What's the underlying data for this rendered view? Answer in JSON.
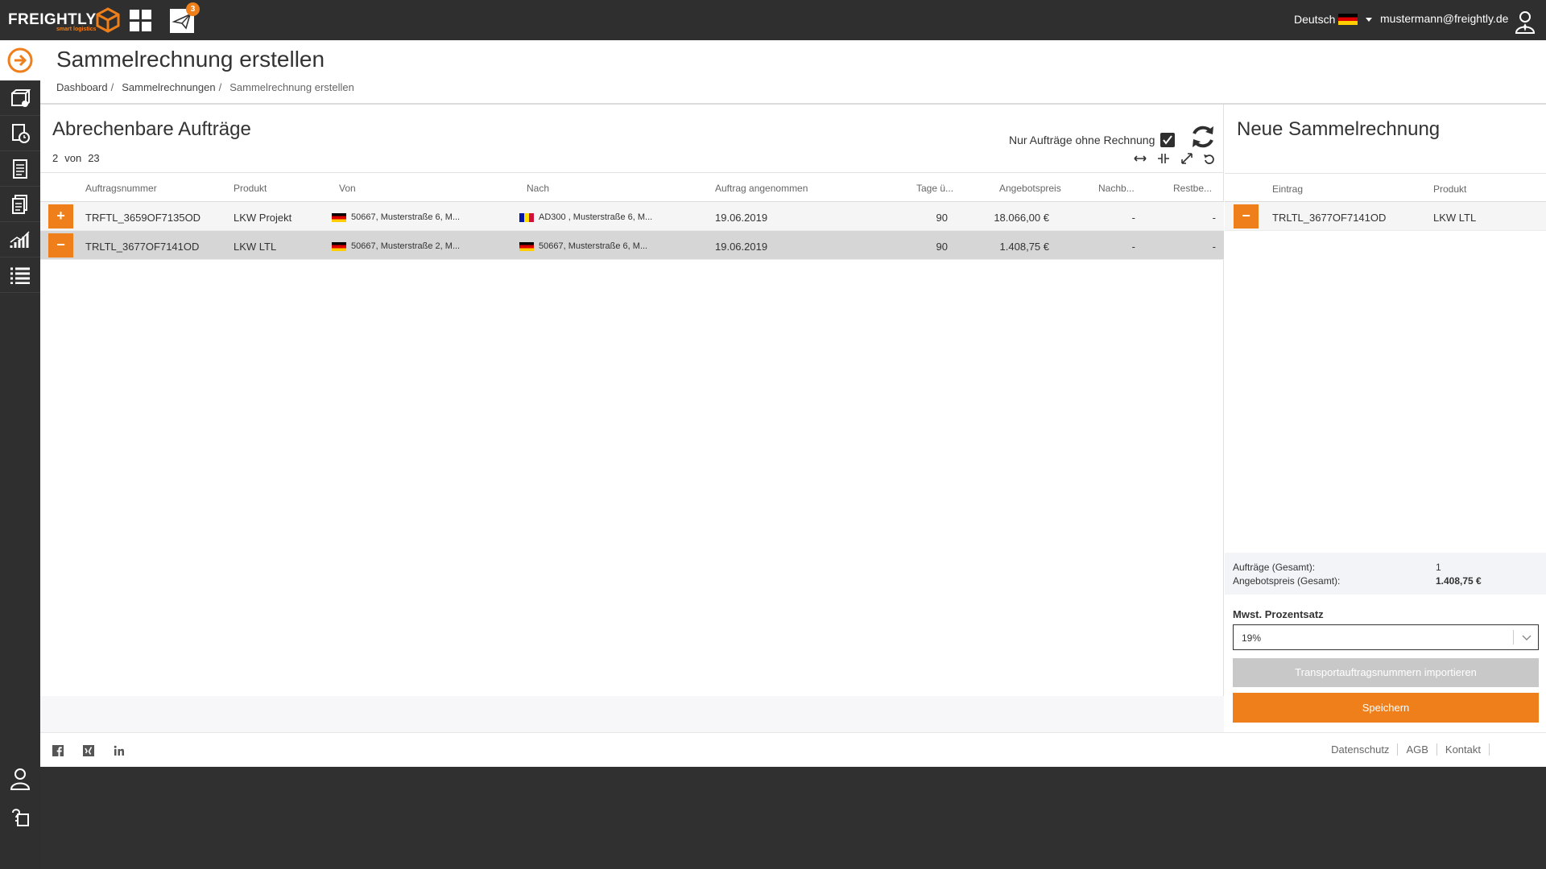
{
  "brand": {
    "name": "FREIGHTLY",
    "tagline": "smart logistics"
  },
  "topbar": {
    "notification_count": "3",
    "language": "Deutsch",
    "user_email": "mustermann@freightly.de"
  },
  "page": {
    "title": "Sammelrechnung erstellen"
  },
  "breadcrumb": [
    {
      "label": "Dashboard"
    },
    {
      "label": "Sammelrechnungen"
    },
    {
      "label": "Sammelrechnung erstellen"
    }
  ],
  "left": {
    "title": "Abrechenbare Aufträge",
    "count_shown": "2",
    "count_of": "von",
    "count_total": "23",
    "filter_label": "Nur Aufträge ohne Rechnung",
    "filter_checked": true,
    "columns": [
      "Auftragsnummer",
      "Produkt",
      "Von",
      "Nach",
      "Auftrag angenommen",
      "Tage ü...",
      "Angebotspreis",
      "Nachb...",
      "Restbe..."
    ],
    "rows": [
      {
        "action": "+",
        "id": "TRFTL_3659OF7135OD",
        "product": "LKW Projekt",
        "from": "50667, Musterstraße 6, M...",
        "to": "AD300 , Musterstraße 6, M...",
        "accepted": "19.06.2019",
        "days": "90",
        "price": "18.066,00 €",
        "nachb": "-",
        "rest": "-"
      },
      {
        "action": "−",
        "id": "TRLTL_3677OF7141OD",
        "product": "LKW LTL",
        "from": "50667, Musterstraße 2, M...",
        "to": "50667, Musterstraße 6, M...",
        "accepted": "19.06.2019",
        "days": "90",
        "price": "1.408,75 €",
        "nachb": "-",
        "rest": "-"
      }
    ]
  },
  "right": {
    "title": "Neue Sammelrechnung",
    "columns": [
      "Eintrag",
      "Produkt"
    ],
    "rows": [
      {
        "action": "−",
        "entry": "TRLTL_3677OF7141OD",
        "product": "LKW LTL"
      }
    ],
    "summary_orders_label": "Aufträge (Gesamt):",
    "summary_orders_value": "1",
    "summary_price_label": "Angebotspreis (Gesamt):",
    "summary_price_value": "1.408,75 €",
    "vat_label": "Mwst. Prozentsatz",
    "vat_value": "19%",
    "import_label": "Transportauftragsnummern importieren",
    "save_label": "Speichern"
  },
  "footer": {
    "links": [
      "Datenschutz",
      "AGB",
      "Kontakt"
    ]
  },
  "colors": {
    "accent": "#ef7f1a",
    "dark": "#2f2f2f"
  }
}
